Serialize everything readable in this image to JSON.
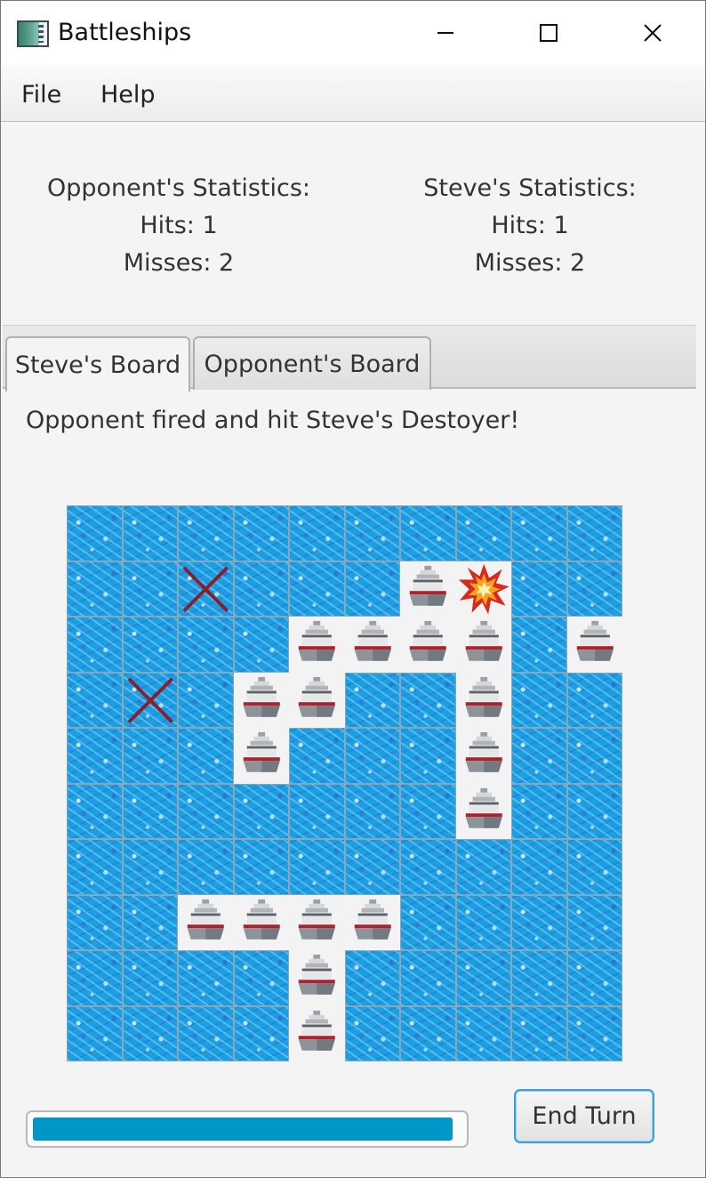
{
  "window": {
    "title": "Battleships"
  },
  "menu": {
    "file": "File",
    "help": "Help"
  },
  "stats": {
    "opponent": {
      "heading": "Opponent's Statistics:",
      "hits": "Hits: 1",
      "misses": "Misses: 2"
    },
    "player": {
      "heading": "Steve's  Statistics:",
      "hits": "Hits: 1",
      "misses": "Misses: 2"
    }
  },
  "tabs": {
    "steve": "Steve's Board",
    "opponent": "Opponent's Board"
  },
  "status_message": "Opponent fired and hit Steve's Destoyer!",
  "board": {
    "rows": [
      "WWWWWWWWWW",
      "WWXWWWSHWW",
      "WWWWSSSSWS",
      "WXWSSWWSWW",
      "WWWSWWWSWW",
      "WWWWWWWSWW",
      "WWWWWWWWWW",
      "WWSSSSWWWW",
      "WWWWSWWWWW",
      "WWWWSWWWWW"
    ],
    "legend": {
      "W": "water",
      "S": "ship",
      "X": "miss",
      "H": "hit"
    }
  },
  "progress": {
    "value": 0.98
  },
  "end_turn_label": "End Turn",
  "colors": {
    "water": "#1aa0e2",
    "miss": "#8b1e2c",
    "progress": "#0096c8",
    "focus": "#3ba0d8"
  }
}
